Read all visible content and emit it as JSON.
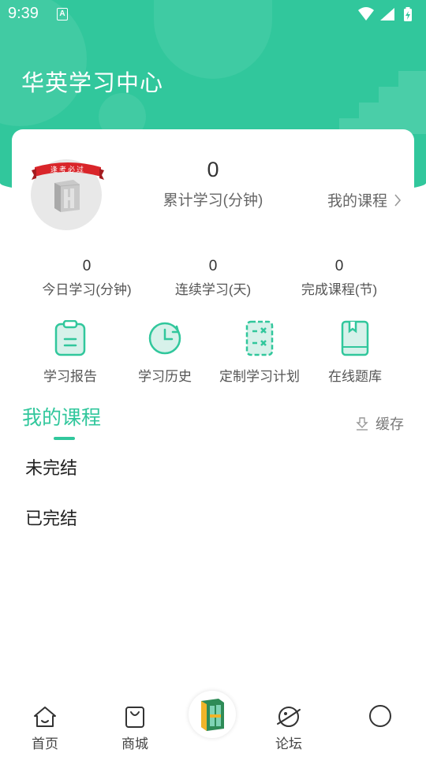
{
  "status_bar": {
    "time": "9:39",
    "notification_letter": "A"
  },
  "header": {
    "title": "华英学习中心"
  },
  "profile": {
    "ribbon_text": "逢考必过",
    "total_minutes": "0",
    "total_label": "累计学习(分钟)",
    "my_courses_link": "我的课程"
  },
  "stats": [
    {
      "value": "0",
      "label": "今日学习(分钟)"
    },
    {
      "value": "0",
      "label": "连续学习(天)"
    },
    {
      "value": "0",
      "label": "完成课程(节)"
    }
  ],
  "features": [
    {
      "label": "学习报告",
      "icon": "clipboard-icon"
    },
    {
      "label": "学习历史",
      "icon": "clock-history-icon"
    },
    {
      "label": "定制学习计划",
      "icon": "plan-icon"
    },
    {
      "label": "在线题库",
      "icon": "book-icon"
    }
  ],
  "courses": {
    "title": "我的课程",
    "cache_label": "缓存",
    "items": [
      "未完结",
      "已完结"
    ]
  },
  "bottom_nav": {
    "items": [
      {
        "label": "首页",
        "icon": "home-icon"
      },
      {
        "label": "商城",
        "icon": "shopping-bag-icon"
      },
      {
        "label": "",
        "icon": "app-logo-icon"
      },
      {
        "label": "论坛",
        "icon": "planet-icon"
      },
      {
        "label": "",
        "icon": "profile-circle-icon"
      }
    ]
  },
  "colors": {
    "accent": "#31c79c",
    "background": "#ffffff"
  }
}
